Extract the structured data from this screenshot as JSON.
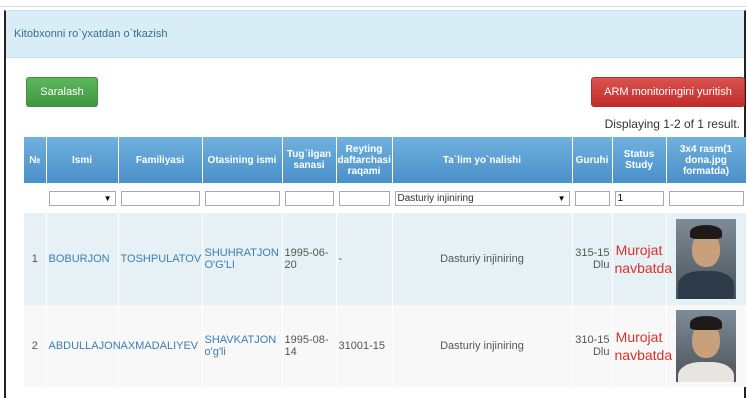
{
  "panel": {
    "title": "Kitobxonni ro`yxatdan o`tkazish"
  },
  "toolbar": {
    "filter_button": "Saralash",
    "monitor_button": "ARM monitoringini yuritish"
  },
  "summary": "Displaying 1-2 of 1 result.",
  "table": {
    "columns": [
      "№",
      "Ismi",
      "Familiyasi",
      "Otasining ismi",
      "Tug`ilgan sanasi",
      "Reyting daftarchasi raqami",
      "Ta`lim yo`nalishi",
      "Guruhi",
      "Status Study",
      "3x4 rasm(1 dona.jpg formatda)"
    ],
    "filters": {
      "direction_selected": "Dasturiy injiniring",
      "status_value": "1"
    },
    "rows": [
      {
        "num": "1",
        "first": "BOBURJON",
        "last": "TOSHPULATOV",
        "father": "SHUHRATJON O'G'LI",
        "birth": "1995-06-20",
        "record": "-",
        "direction": "Dasturiy injiniring",
        "group": "315-15 Dlu",
        "status": "Murojat navbatda"
      },
      {
        "num": "2",
        "first": "ABDULLAJON",
        "last": "AXMADALIYEV",
        "father": "SHAVKATJON o'g'li",
        "birth": "1995-08-14",
        "record": "31001-15",
        "direction": "Dasturiy injiniring",
        "group": "310-15 Dlu",
        "status": "Murojat navbatda"
      }
    ]
  },
  "icons": {
    "dropdown": "chevron-down-icon",
    "photo": "student-photo"
  }
}
